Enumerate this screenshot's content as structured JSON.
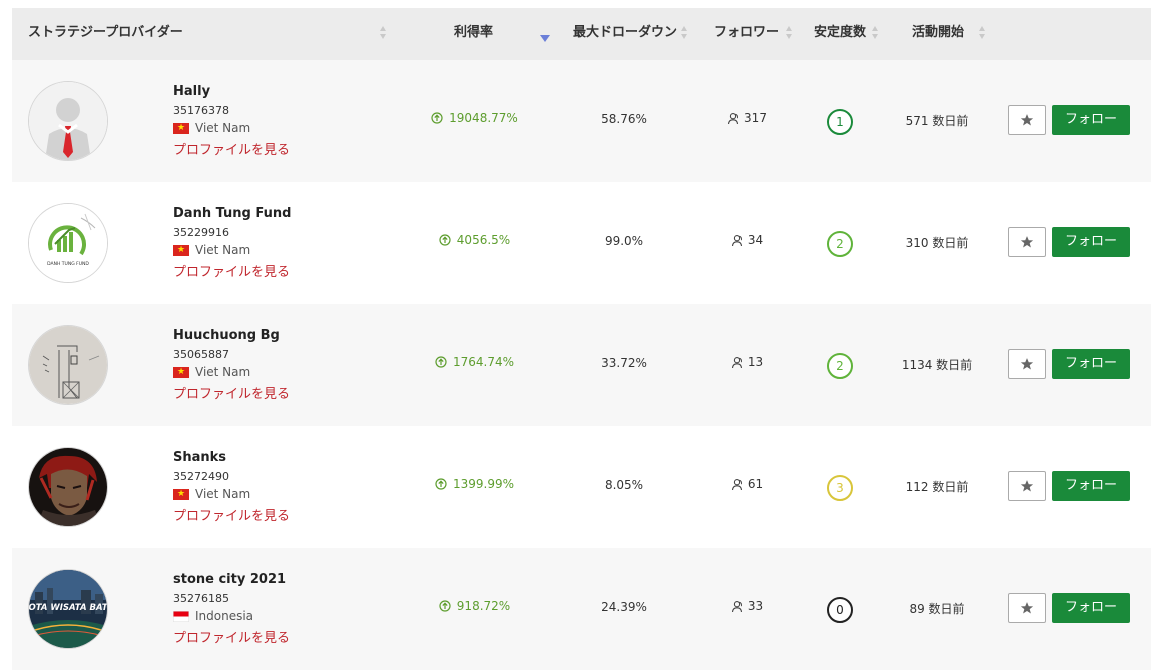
{
  "header": {
    "provider": "ストラテジープロバイダー",
    "gain": "利得率",
    "drawdown": "最大ドローダウン",
    "followers": "フォロワー",
    "stability": "安定度数",
    "started": "活動開始"
  },
  "colors": {
    "header_bg": "#ececec",
    "gain_green": "#5d9d2e",
    "follow_green": "#1a8a3a",
    "link_red": "#c0262d",
    "sort_active": "#6b7fd8"
  },
  "rows": [
    {
      "name": "Hally",
      "account": "35176378",
      "country": "Viet Nam",
      "flag": "flag-vietnam-icon",
      "profile_link": "プロファイルを見る",
      "gain": "19048.77%",
      "drawdown": "58.76%",
      "followers": "317",
      "stability": "1",
      "stability_color": "#1a8a3a",
      "started": "571 数日前",
      "follow_label": "フォロー",
      "avatar": "default-user-silhouette"
    },
    {
      "name": "Danh Tung Fund",
      "account": "35229916",
      "country": "Viet Nam",
      "flag": "flag-vietnam-icon",
      "profile_link": "プロファイルを見る",
      "gain": "4056.5%",
      "drawdown": "99.0%",
      "followers": "34",
      "stability": "2",
      "stability_color": "#5fb33a",
      "started": "310 数日前",
      "follow_label": "フォロー",
      "avatar": "fund-logo"
    },
    {
      "name": "Huuchuong Bg",
      "account": "35065887",
      "country": "Viet Nam",
      "flag": "flag-vietnam-icon",
      "profile_link": "プロファイルを見る",
      "gain": "1764.74%",
      "drawdown": "33.72%",
      "followers": "13",
      "stability": "2",
      "stability_color": "#5fb33a",
      "started": "1134 数日前",
      "follow_label": "フォロー",
      "avatar": "sketch-photo"
    },
    {
      "name": "Shanks",
      "account": "35272490",
      "country": "Viet Nam",
      "flag": "flag-vietnam-icon",
      "profile_link": "プロファイルを見る",
      "gain": "1399.99%",
      "drawdown": "8.05%",
      "followers": "61",
      "stability": "3",
      "stability_color": "#d8c53a",
      "started": "112 数日前",
      "follow_label": "フォロー",
      "avatar": "anime-character-photo"
    },
    {
      "name": "stone city 2021",
      "account": "35276185",
      "country": "Indonesia",
      "flag": "flag-indonesia-icon",
      "profile_link": "プロファイルを見る",
      "gain": "918.72%",
      "drawdown": "24.39%",
      "followers": "33",
      "stability": "0",
      "stability_color": "#222222",
      "started": "89 数日前",
      "follow_label": "フォロー",
      "avatar": "city-night-photo",
      "avatar_text": "OTA WISATA BAT"
    }
  ]
}
